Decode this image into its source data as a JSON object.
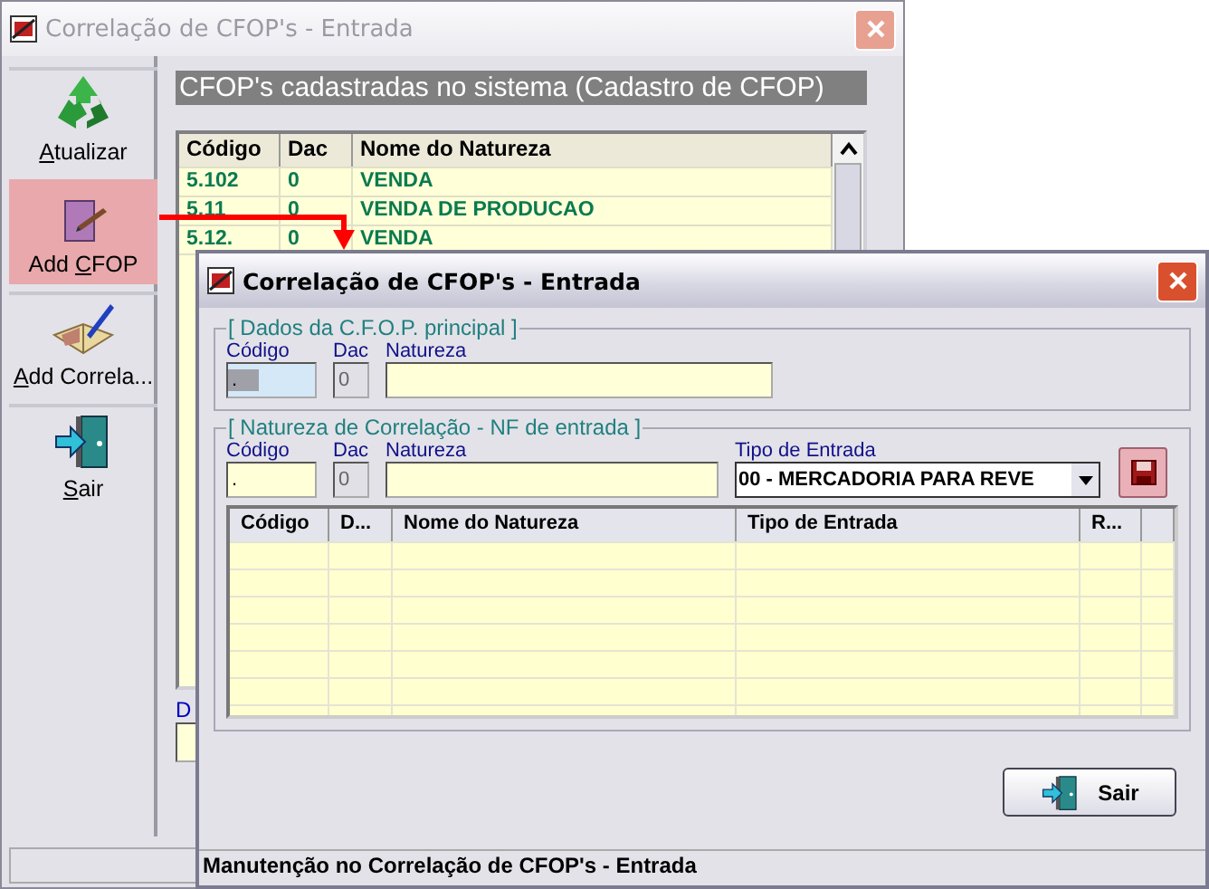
{
  "back_window": {
    "title": "Correlação de CFOP's - Entrada",
    "active": false,
    "toolbar": [
      {
        "key": "A",
        "rest": "tualizar",
        "selected": false
      },
      {
        "lead": "Add ",
        "key": "C",
        "rest": "FOP",
        "selected": true
      },
      {
        "key": "A",
        "rest": "dd Correla...",
        "selected": false
      },
      {
        "key": "S",
        "rest": "air",
        "selected": false
      }
    ],
    "header": "CFOP's cadastradas no sistema (Cadastro de CFOP)",
    "table": {
      "columns": [
        "Código",
        "Dac",
        "Nome do Natureza"
      ],
      "rows": [
        [
          "5.102",
          "0",
          "VENDA"
        ],
        [
          "5.11",
          "0",
          "VENDA DE PRODUCAO"
        ],
        [
          "5.12.",
          "0",
          "VENDA"
        ]
      ]
    },
    "partial_label": "D"
  },
  "dialog": {
    "title": "Correlação de CFOP's - Entrada",
    "active": true,
    "groups": [
      {
        "title": "[ Dados da C.F.O.P. principal ]",
        "fields": [
          {
            "label": "Código",
            "value": ".",
            "focused": true,
            "disabled": false
          },
          {
            "label": "Dac",
            "value": "0",
            "focused": false,
            "disabled": true
          },
          {
            "label": "Natureza",
            "focused": false,
            "disabled": false
          }
        ]
      },
      {
        "title": "[ Natureza de Correlação - NF de entrada ]",
        "fields": [
          {
            "label": "Código",
            "value": ".",
            "focused": false,
            "disabled": false
          },
          {
            "label": "Dac",
            "value": "0",
            "focused": false,
            "disabled": true
          },
          {
            "label": "Natureza",
            "focused": false,
            "disabled": false
          }
        ],
        "combo": {
          "label": "Tipo de Entrada",
          "value": "00 - MERCADORIA PARA REVE"
        },
        "save_hover": true
      }
    ],
    "table": {
      "columns": [
        "Código",
        "D...",
        "Nome do Natureza",
        "Tipo de Entrada",
        "R..."
      ]
    },
    "exit_button": "Sair",
    "status_bar": "Manutenção no Correlação de CFOP's - Entrada"
  }
}
